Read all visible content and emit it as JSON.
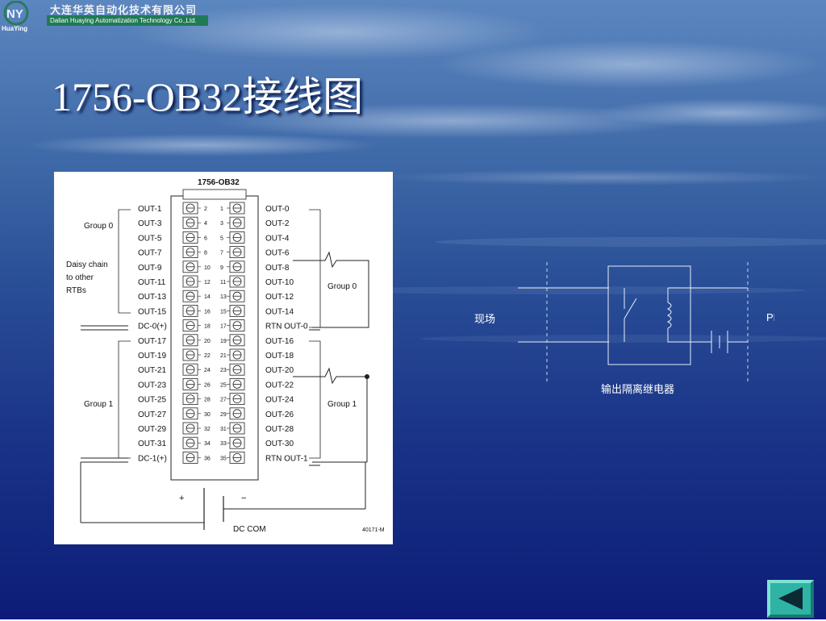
{
  "header": {
    "company_cn": "大连华英自动化技术有限公司",
    "company_en": "Dalian Huaying Automatization  Technology Co.,Ltd.",
    "brand": "HuaYing",
    "logo_letters": "NY"
  },
  "title": "1756-OB32接线图",
  "wiring": {
    "module_title": "1756-OB32",
    "left_outputs": [
      "OUT-1",
      "OUT-3",
      "OUT-5",
      "OUT-7",
      "OUT-9",
      "OUT-11",
      "OUT-13",
      "OUT-15",
      "DC-0(+)",
      "OUT-17",
      "OUT-19",
      "OUT-21",
      "OUT-23",
      "OUT-25",
      "OUT-27",
      "OUT-29",
      "OUT-31",
      "DC-1(+)"
    ],
    "right_outputs": [
      "OUT-0",
      "OUT-2",
      "OUT-4",
      "OUT-6",
      "OUT-8",
      "OUT-10",
      "OUT-12",
      "OUT-14",
      "RTN OUT-0",
      "OUT-16",
      "OUT-18",
      "OUT-20",
      "OUT-22",
      "OUT-24",
      "OUT-26",
      "OUT-28",
      "OUT-30",
      "RTN OUT-1"
    ],
    "left_pins": [
      "2",
      "4",
      "6",
      "8",
      "10",
      "12",
      "14",
      "16",
      "18",
      "20",
      "22",
      "24",
      "26",
      "28",
      "30",
      "32",
      "34",
      "36"
    ],
    "right_pins": [
      "1",
      "3",
      "5",
      "7",
      "9",
      "11",
      "13",
      "15",
      "17",
      "19",
      "21",
      "23",
      "25",
      "27",
      "29",
      "31",
      "33",
      "35"
    ],
    "group0_left": "Group 0",
    "group1_left": "Group 1",
    "group0_right": "Group 0",
    "group1_right": "Group 1",
    "daisy_chain": [
      "Daisy chain",
      "to other",
      "RTBs"
    ],
    "plus": "+",
    "minus": "−",
    "dc_com": "DC COM",
    "figure_id": "40171-M"
  },
  "relay": {
    "field_label": "现场",
    "plc_label": "PLC",
    "caption": "输出隔离继电器"
  },
  "colors": {
    "sky_top": "#4f78b4",
    "sea_bottom": "#0e1f7a",
    "nav_bg": "#2fb3a4"
  },
  "icons": {
    "nav": "back-triangle-icon"
  }
}
